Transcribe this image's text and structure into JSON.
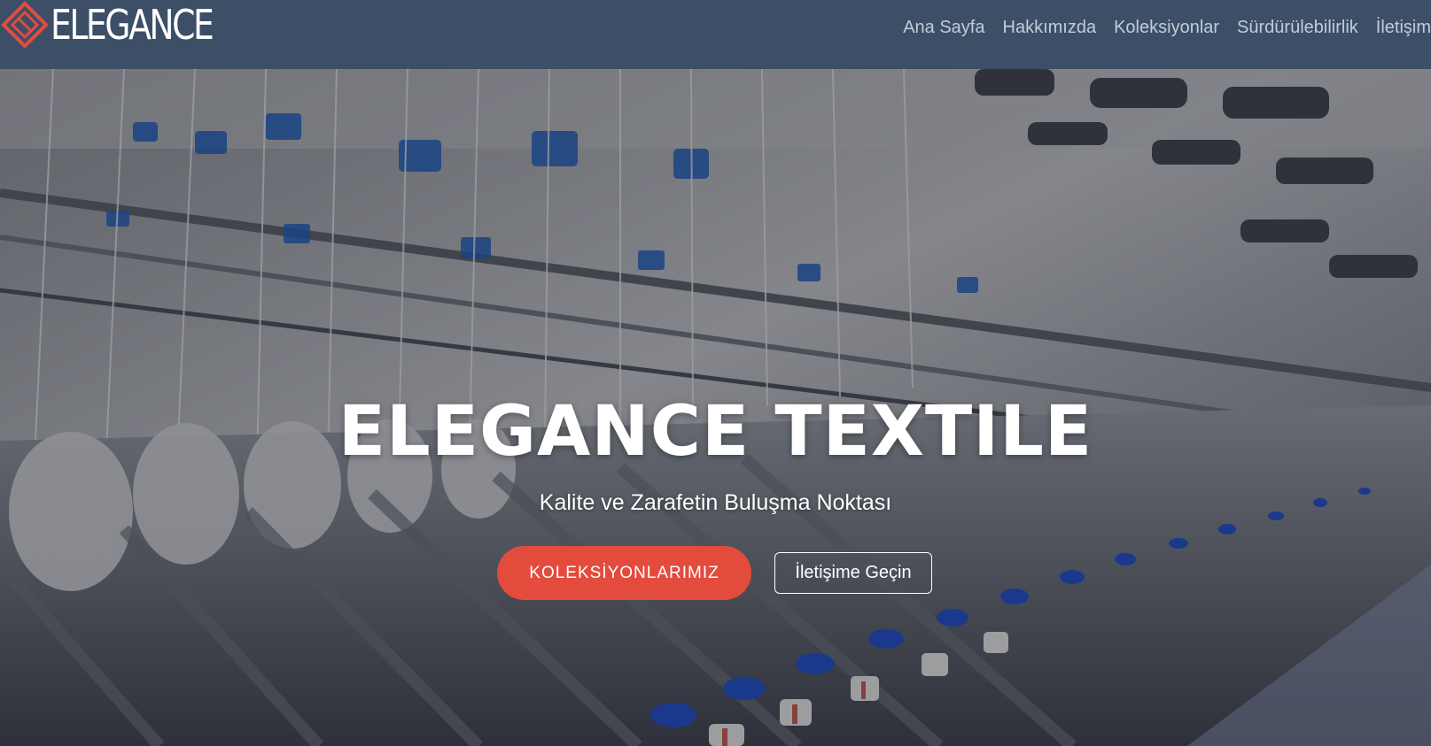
{
  "header": {
    "brand": "ELEGANCE",
    "nav": [
      {
        "label": "Ana Sayfa"
      },
      {
        "label": "Hakkımızda"
      },
      {
        "label": "Koleksiyonlar"
      },
      {
        "label": "Sürdürülebilirlik"
      },
      {
        "label": "İletişim"
      }
    ]
  },
  "hero": {
    "title": "ELEGANCE TEXTILE",
    "subtitle": "Kalite ve Zarafetin Buluşma Noktası",
    "primary_button": "KOLEKSİYONLARIMIZ",
    "secondary_button": "İletişime Geçin",
    "background_image": "textile-spinning-machine-photo"
  },
  "colors": {
    "header_bg": "#3c4f67",
    "accent": "#e34b3d",
    "nav_text": "#c3ccd8",
    "white": "#ffffff"
  }
}
